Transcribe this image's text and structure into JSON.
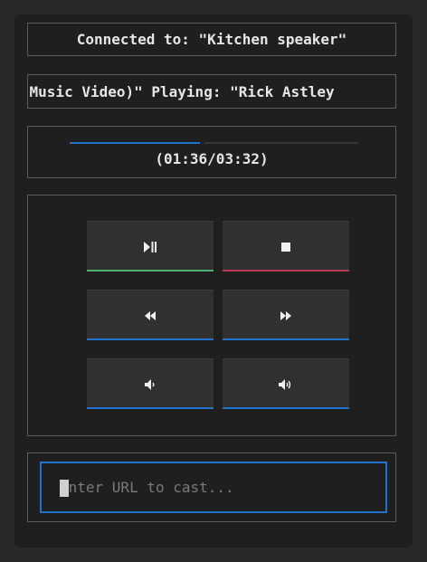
{
  "status": {
    "text": "Connected to: \"Kitchen speaker\""
  },
  "now_playing": {
    "marquee": "ial Music Video)\" Playing: \"Rick Astley"
  },
  "progress": {
    "fraction": 0.453,
    "time_label": "(01:36/03:32)"
  },
  "controls": {
    "play_pause": {
      "icon": "play-pause-icon",
      "accent": "#4caf6e"
    },
    "stop": {
      "icon": "stop-icon",
      "accent": "#b83a55"
    },
    "rewind": {
      "icon": "rewind-icon",
      "accent": "#1f74c9"
    },
    "fast_forward": {
      "icon": "fast-forward-icon",
      "accent": "#1f74c9"
    },
    "volume_down": {
      "icon": "volume-down-icon",
      "accent": "#1f74c9"
    },
    "volume_up": {
      "icon": "volume-up-icon",
      "accent": "#1f74c9"
    }
  },
  "url_input": {
    "value": "",
    "placeholder": "Enter URL to cast..."
  },
  "colors": {
    "focus": "#1f74c9",
    "background": "#1f1f1f"
  }
}
